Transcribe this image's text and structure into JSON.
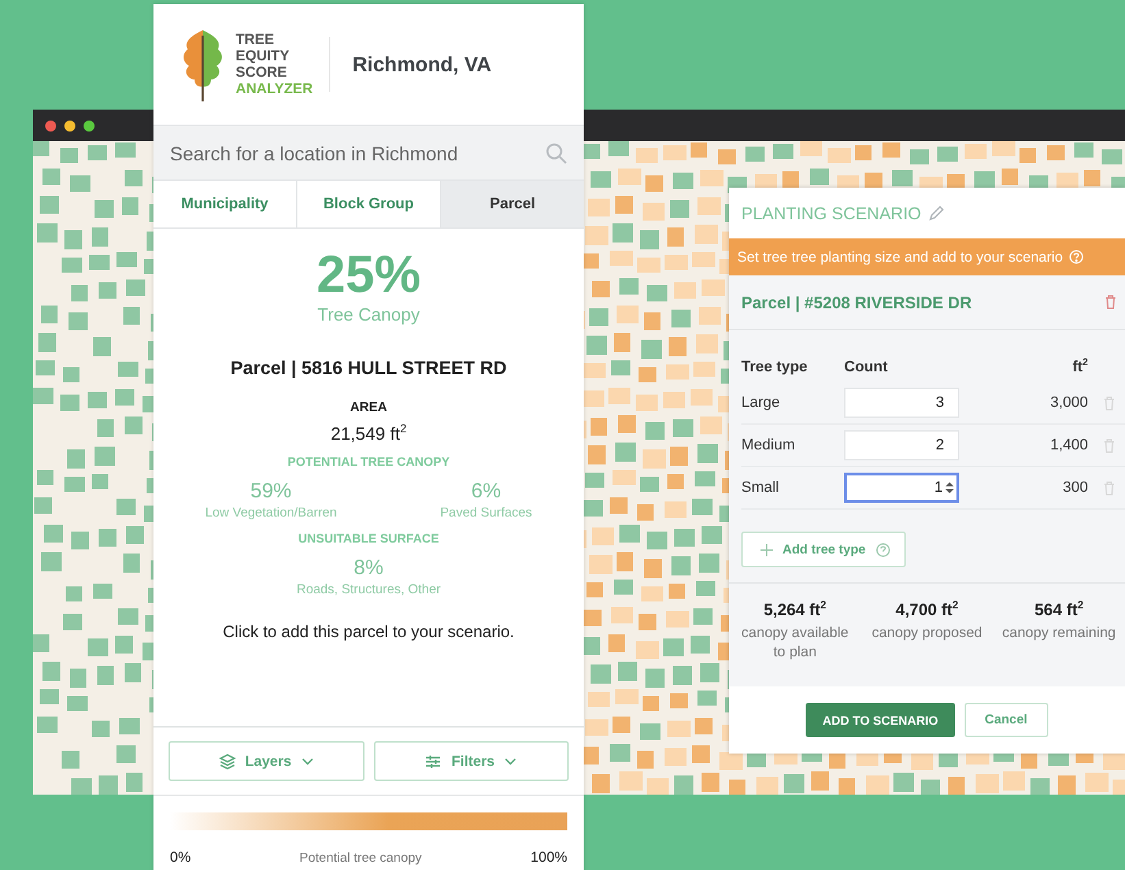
{
  "sidebar": {
    "logo": [
      {
        "text": "TREE",
        "accent": false
      },
      {
        "text": "EQUITY",
        "accent": false
      },
      {
        "text": "SCORE",
        "accent": false
      },
      {
        "text": "ANALYZER",
        "accent": true
      }
    ],
    "city": "Richmond, VA",
    "search": {
      "placeholder": "Search for a location in Richmond"
    },
    "tabs": [
      {
        "label": "Municipality",
        "selected": false
      },
      {
        "label": "Block Group",
        "selected": false
      },
      {
        "label": "Parcel",
        "selected": true
      }
    ],
    "canopy": {
      "value": "25%",
      "label": "Tree Canopy"
    },
    "parcel_title": "Parcel | 5816 HULL STREET RD",
    "area": {
      "label": "AREA",
      "value": "21,549 ft$^{2}$"
    },
    "sections": [
      {
        "heading": "POTENTIAL TREE CANOPY",
        "stats": [
          {
            "value": "59%",
            "label": "Low Vegetation/Barren"
          },
          {
            "value": "6%",
            "label": "Paved Surfaces"
          }
        ]
      },
      {
        "heading": "UNSUITABLE SURFACE",
        "stats": [
          {
            "value": "8%",
            "label": "Roads, Structures, Other"
          }
        ]
      }
    ],
    "hint": "Click to add this parcel to your scenario.",
    "buttons": [
      {
        "label": "Layers",
        "kind": "layers"
      },
      {
        "label": "Filters",
        "kind": "filters"
      }
    ],
    "legend": {
      "min": "0%",
      "label": "Potential tree canopy",
      "max": "100%"
    }
  },
  "scenario": {
    "title": "PLANTING SCENARIO",
    "banner": "Set tree tree planting size and add to your scenario",
    "parcel": "Parcel | #5208 RIVERSIDE DR",
    "columns": [
      "Tree type",
      "Count",
      "ft$^{2}$"
    ],
    "rows": [
      {
        "type": "Large",
        "count": "3",
        "area": "3,000",
        "focused": false
      },
      {
        "type": "Medium",
        "count": "2",
        "area": "1,400",
        "focused": false
      },
      {
        "type": "Small",
        "count": "1",
        "area": "300",
        "focused": true
      }
    ],
    "add_button": "Add tree type",
    "summary": [
      {
        "value": "5,264 ft$^{2}$",
        "label": "canopy available to plan"
      },
      {
        "value": "4,700 ft$^{2}$",
        "label": "canopy proposed"
      },
      {
        "value": "564 ft$^{2}$",
        "label": "canopy remaining"
      }
    ],
    "buttons": [
      {
        "label": "ADD TO SCENARIO",
        "kind": "primary"
      },
      {
        "label": "Cancel",
        "kind": "secondary"
      }
    ]
  }
}
